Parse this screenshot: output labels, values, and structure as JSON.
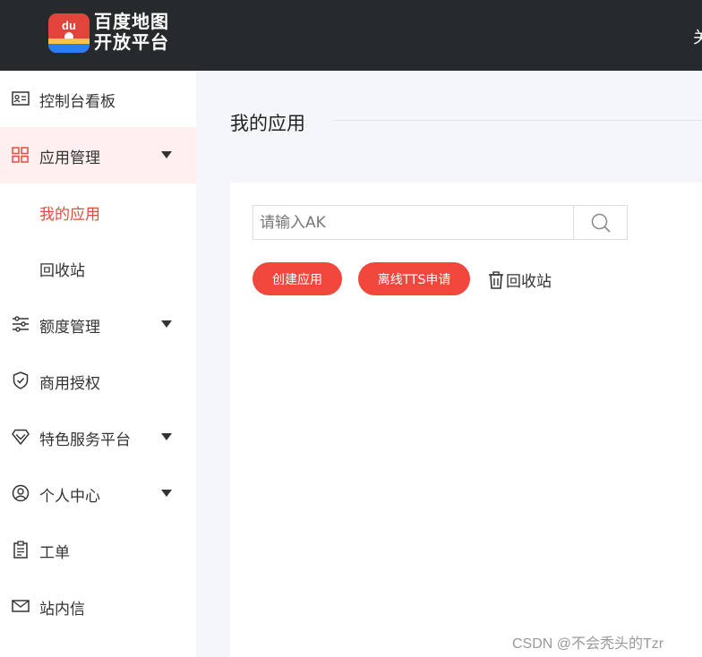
{
  "header": {
    "logo_line1": "百度地图",
    "logo_line2": "开放平台",
    "logo_badge": "du",
    "right_text": "关"
  },
  "sidebar": {
    "items": [
      {
        "label": "控制台看板",
        "icon": "dashboard-card-icon"
      },
      {
        "label": "应用管理",
        "icon": "grid-apps-icon",
        "expanded": true
      },
      {
        "label": "我的应用",
        "sub": true,
        "selected": true
      },
      {
        "label": "回收站",
        "sub": true
      },
      {
        "label": "额度管理",
        "icon": "sliders-icon",
        "expandable": true
      },
      {
        "label": "商用授权",
        "icon": "shield-check-icon"
      },
      {
        "label": "特色服务平台",
        "icon": "gem-icon",
        "expandable": true
      },
      {
        "label": "个人中心",
        "icon": "user-circle-icon",
        "expandable": true
      },
      {
        "label": "工单",
        "icon": "clipboard-icon"
      },
      {
        "label": "站内信",
        "icon": "mail-icon"
      }
    ]
  },
  "main": {
    "title": "我的应用",
    "search": {
      "placeholder": "请输入AK",
      "value": ""
    },
    "buttons": {
      "create": "创建应用",
      "tts": "离线TTS申请",
      "recycle": "回收站"
    }
  },
  "watermark": "CSDN @不会秃头的Tzr",
  "colors": {
    "topbar": "#262a2c",
    "accent": "#f2473d",
    "active_bg": "#fdf0ef",
    "selected_text": "#e64a3b"
  }
}
